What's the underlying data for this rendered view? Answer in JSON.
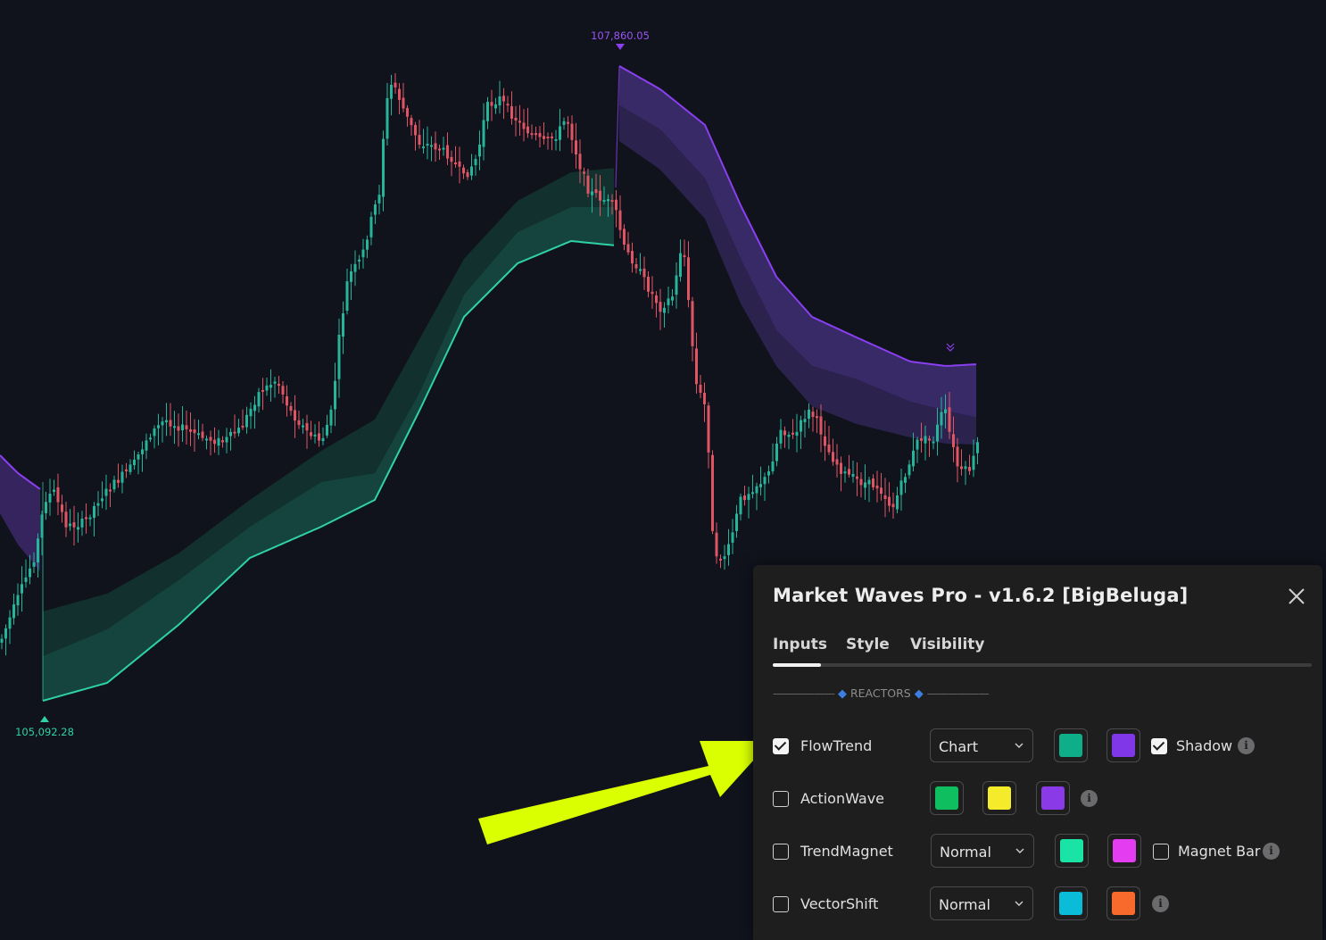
{
  "chart_labels": {
    "high_price": "107,860.05",
    "low_price": "105,092.28"
  },
  "colors": {
    "bull": "#26b59a",
    "bear": "#e05563",
    "bear_band": "#3a2766",
    "bear_line": "#8a3ff0",
    "bull_band": "#123a36",
    "bull_line": "#2fd1a6",
    "arrow": "#d9ff00",
    "background": "#10131c"
  },
  "dialog": {
    "title": "Market Waves Pro - v1.6.2 [BigBeluga]",
    "close_icon": "close-icon",
    "tabs": [
      {
        "label": "Inputs",
        "active": true
      },
      {
        "label": "Style",
        "active": false
      },
      {
        "label": "Visibility",
        "active": false
      }
    ],
    "section": {
      "dashes": "——————",
      "label": "REACTORS"
    },
    "rows": [
      {
        "label": "FlowTrend",
        "checked": true,
        "select": "Chart",
        "swatches": [
          "#0fae8a",
          "#7f37e8"
        ],
        "extra_checkbox": {
          "label": "Shadow",
          "checked": true
        }
      },
      {
        "label": "ActionWave",
        "checked": false,
        "swatches": [
          "#0fbf5f",
          "#f4ec2a",
          "#8a3ae6"
        ]
      },
      {
        "label": "TrendMagnet",
        "checked": false,
        "select": "Normal",
        "swatches": [
          "#19e4a6",
          "#e43cf0"
        ],
        "extra_checkbox": {
          "label": "Magnet Bar",
          "checked": false
        }
      },
      {
        "label": "VectorShift",
        "checked": false,
        "select": "Normal",
        "swatches": [
          "#0bbcd8",
          "#f76a2c"
        ]
      }
    ]
  }
}
